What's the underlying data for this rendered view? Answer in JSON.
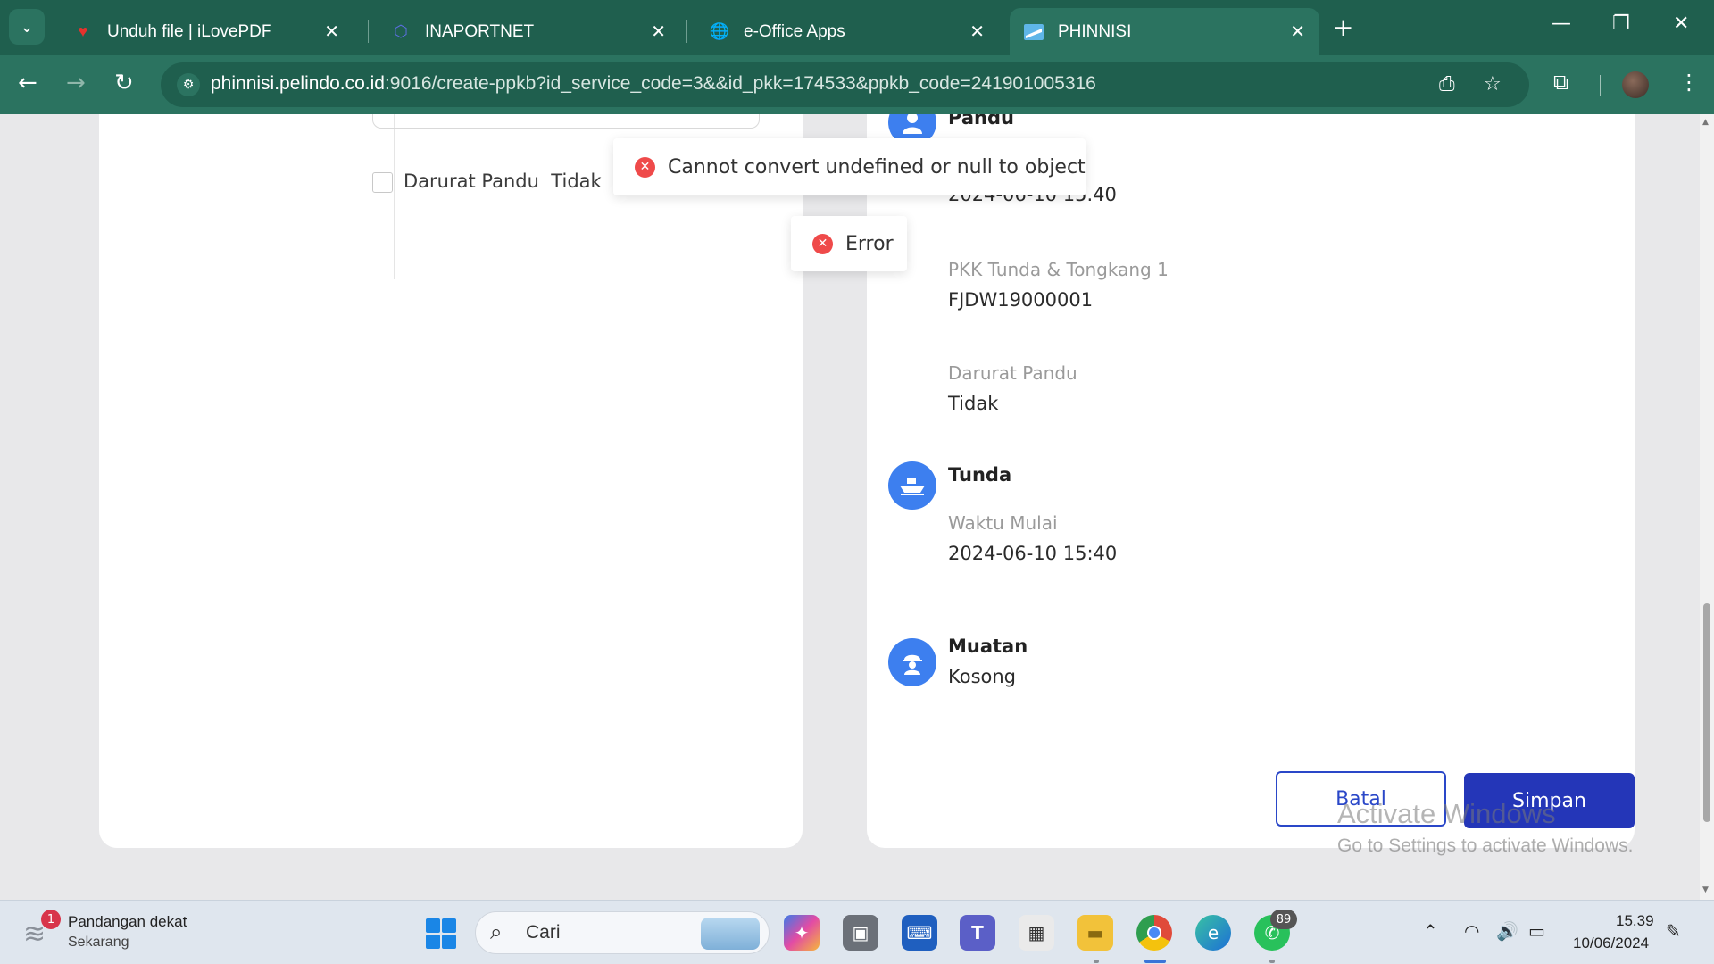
{
  "browser": {
    "tabs": [
      {
        "title": "Unduh file | iLovePDF",
        "icon": "ilovepdf-heart-icon"
      },
      {
        "title": "INAPORTNET",
        "icon": "inaportnet-icon"
      },
      {
        "title": "e-Office Apps",
        "icon": "globe-icon"
      },
      {
        "title": "PHINNISI",
        "icon": "phinnisi-icon",
        "active": true
      }
    ],
    "url_host": "phinnisi.pelindo.co.id",
    "url_rest": ":9016/create-ppkb?id_service_code=3&&id_pkk=174533&ppkb_code=241901005316"
  },
  "form": {
    "checkbox_label": "Darurat Pandu",
    "checkbox_value": "Tidak",
    "checked": false
  },
  "summary": {
    "pandu": {
      "title": "Pandu",
      "time_value": "2024-06-10 15.40",
      "pkk_label": "PKK Tunda & Tongkang 1",
      "pkk_value": "FJDW19000001",
      "darurat_label": "Darurat Pandu",
      "darurat_value": "Tidak"
    },
    "tunda": {
      "title": "Tunda",
      "waktu_label": "Waktu Mulai",
      "waktu_value": "2024-06-10 15:40"
    },
    "muatan": {
      "title": "Muatan",
      "value": "Kosong"
    }
  },
  "toasts": {
    "primary": "Cannot convert undefined or null to object",
    "secondary": "Error"
  },
  "actions": {
    "cancel": "Batal",
    "save": "Simpan"
  },
  "watermark": {
    "line1": "Activate Windows",
    "line2": "Go to Settings to activate Windows."
  },
  "taskbar": {
    "weather_title": "Pandangan dekat",
    "weather_sub": "Sekarang",
    "weather_badge": "1",
    "search_placeholder": "Cari",
    "whatsapp_badge": "89",
    "time": "15.39",
    "date": "10/06/2024"
  },
  "colors": {
    "chrome_dark": "#1f5f4e",
    "chrome": "#2b7360",
    "accent_blue": "#3d7fef",
    "save_button": "#2436b8",
    "error_red": "#ef4a4a"
  }
}
